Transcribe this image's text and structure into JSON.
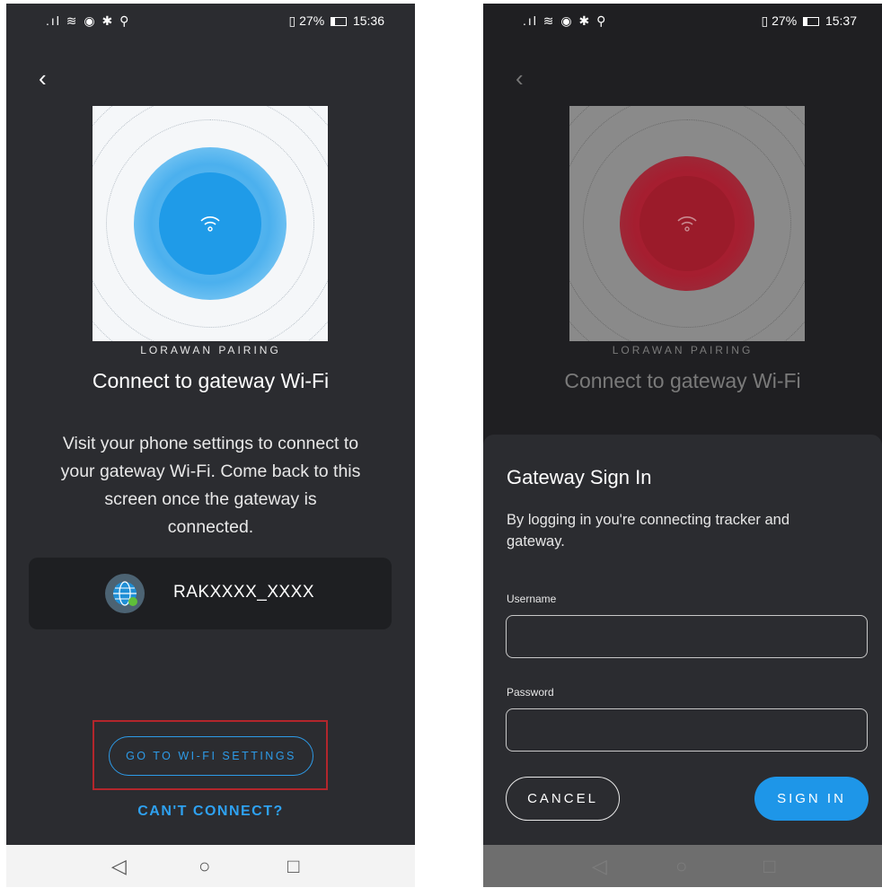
{
  "colors": {
    "accent": "#2d9be8",
    "highlight": "#b3262c",
    "error_red": "#9b1b2a"
  },
  "left_screen": {
    "status": {
      "signal_icons": ".ıl ≋ ◉ ✱ ⚲",
      "battery": "27%",
      "time": "15:36"
    },
    "subtitle": "LORAWAN PAIRING",
    "title": "Connect to gateway Wi-Fi",
    "description": "Visit your phone settings to connect to your gateway Wi-Fi. Come back to this screen once the gateway is connected.",
    "network_name": "RAKXXXX_XXXX",
    "primary_button": "GO TO WI-FI SETTINGS",
    "secondary_link": "CAN'T CONNECT?"
  },
  "right_screen": {
    "status": {
      "signal_icons": ".ıl ≋ ◉ ✱ ⚲",
      "battery": "27%",
      "time": "15:37"
    },
    "subtitle": "LORAWAN PAIRING",
    "title": "Connect to gateway Wi-Fi",
    "dialog": {
      "title": "Gateway Sign In",
      "description": "By logging in you're connecting tracker and gateway.",
      "username_label": "Username",
      "username_value": "",
      "password_label": "Password",
      "password_value": "",
      "cancel_label": "CANCEL",
      "signin_label": "SIGN IN"
    }
  },
  "nav": {
    "back": "◁",
    "home": "○",
    "recents": "□"
  }
}
